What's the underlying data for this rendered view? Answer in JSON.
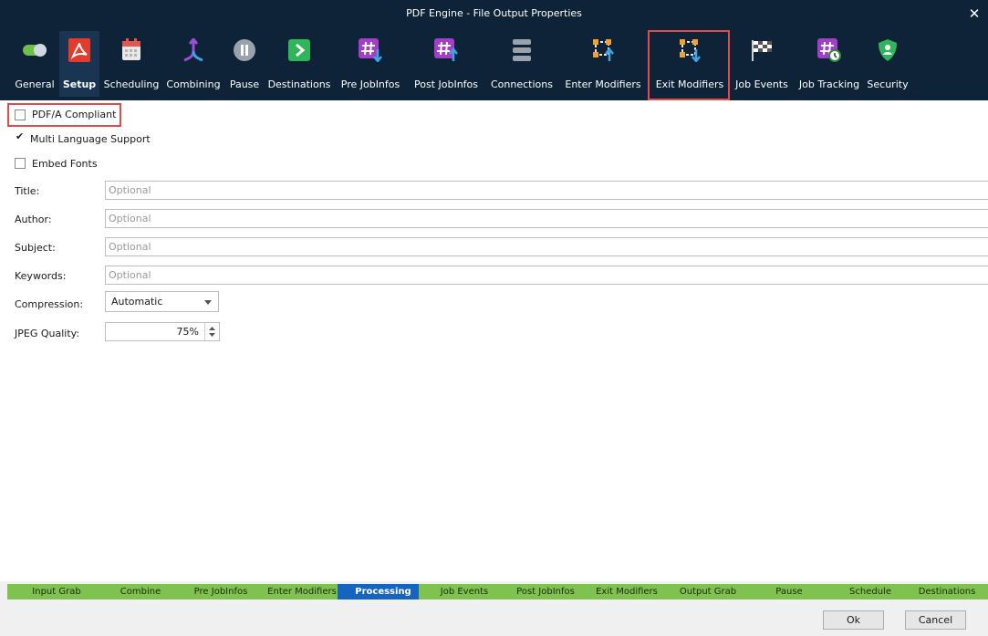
{
  "window": {
    "title": "PDF Engine - File Output Properties",
    "close_glyph": "✕"
  },
  "toolbar": [
    {
      "label": "General",
      "icon": "toggle-icon",
      "selected": false
    },
    {
      "label": "Setup",
      "icon": "pdf-icon",
      "selected": true
    },
    {
      "label": "Scheduling",
      "icon": "calendar-icon",
      "selected": false
    },
    {
      "label": "Combining",
      "icon": "merge-icon",
      "selected": false
    },
    {
      "label": "Pause",
      "icon": "pause-icon",
      "selected": false
    },
    {
      "label": "Destinations",
      "icon": "destination-icon",
      "selected": false
    },
    {
      "label": "Pre JobInfos",
      "icon": "hash-down-icon",
      "selected": false
    },
    {
      "label": "Post JobInfos",
      "icon": "hash-up-icon",
      "selected": false
    },
    {
      "label": "Connections",
      "icon": "database-icon",
      "selected": false
    },
    {
      "label": "Enter Modifiers",
      "icon": "enter-modifier-icon",
      "selected": false
    },
    {
      "label": "Exit Modifiers",
      "icon": "exit-modifier-icon",
      "selected": false
    },
    {
      "label": "Job Events",
      "icon": "checkered-flag-icon",
      "selected": false
    },
    {
      "label": "Job Tracking",
      "icon": "hash-clock-icon",
      "selected": false
    },
    {
      "label": "Security",
      "icon": "shield-user-icon",
      "selected": false
    }
  ],
  "options": {
    "pdfa": {
      "label": "PDF/A Compliant",
      "checked": false
    },
    "multilang": {
      "label": "Multi Language Support",
      "checked": true,
      "mark": "✔"
    },
    "embed": {
      "label": "Embed Fonts",
      "checked": false
    }
  },
  "fields": {
    "title": {
      "label": "Title:",
      "placeholder": "Optional"
    },
    "author": {
      "label": "Author:",
      "placeholder": "Optional"
    },
    "subject": {
      "label": "Subject:",
      "placeholder": "Optional"
    },
    "keywords": {
      "label": "Keywords:",
      "placeholder": "Optional"
    }
  },
  "compression": {
    "label": "Compression:",
    "value": "Automatic"
  },
  "jpeg": {
    "label": "JPEG Quality:",
    "value": "75%"
  },
  "tabs": [
    "Input Grab",
    "Combine",
    "Pre JobInfos",
    "Enter Modifiers",
    "Processing",
    "Job Events",
    "Post JobInfos",
    "Exit Modifiers",
    "Output Grab",
    "Pause",
    "Schedule",
    "Destinations"
  ],
  "active_tab": "Processing",
  "buttons": {
    "ok": "Ok",
    "cancel": "Cancel"
  },
  "colors": {
    "titlebar": "#0e2338",
    "highlight": "#e24b4b",
    "tab_green": "#7fc24f",
    "tab_active": "#1565c0"
  }
}
